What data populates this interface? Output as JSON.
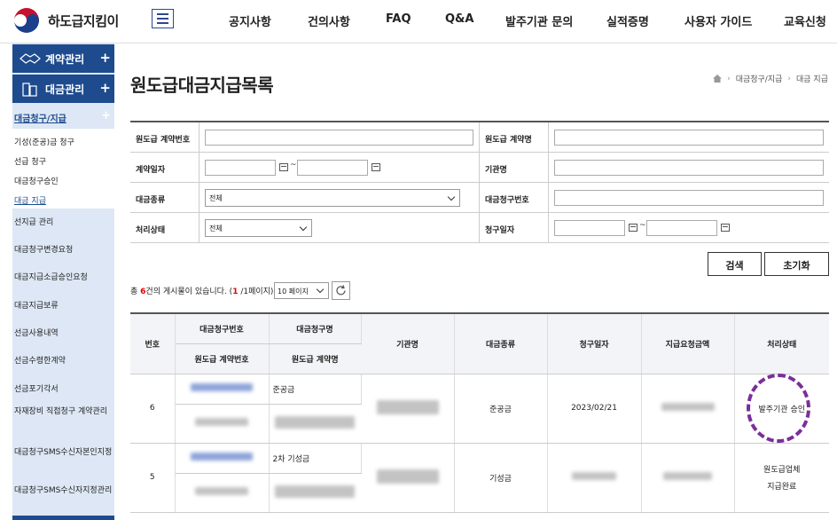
{
  "header": {
    "logo_text": "하도급지킴이",
    "nav": [
      "공지사항",
      "건의사항",
      "FAQ",
      "Q&A",
      "발주기관 문의",
      "실적증명",
      "사용자 가이드",
      "교육신청"
    ]
  },
  "sidebar": {
    "sections": [
      {
        "label": "계약관리",
        "icon": "handshake-icon"
      },
      {
        "label": "대금관리",
        "icon": "building-icon"
      }
    ],
    "submenu_title": "대금청구/지급",
    "submenu_items": [
      "기성(준공)금 청구",
      "선급 청구",
      "대금청구승인",
      "대금 지급"
    ],
    "items": [
      "선지급 관리",
      "대금청구변경요청",
      "대금지급소급승인요청",
      "대금지급보류",
      "선금사용내역",
      "선금수령한계약",
      "선금포기각서",
      "자재장비 직접청구 계약관리",
      "대금청구SMS수신자본인지정",
      "대금청구SMS수신자지정관리"
    ]
  },
  "page": {
    "title": "원도급대금지급목록",
    "breadcrumb": [
      "대금청구/지급",
      "대금 지급"
    ]
  },
  "form": {
    "contract_no_label": "원도급 계약번호",
    "contract_name_label": "원도급 계약명",
    "contract_date_label": "계약일자",
    "agency_label": "기관명",
    "payment_type_label": "대금종류",
    "payment_type_value": "전체",
    "claim_no_label": "대금청구번호",
    "status_label": "처리상태",
    "status_value": "전체",
    "claim_date_label": "청구일자",
    "tilde": "~",
    "search_button": "검색",
    "reset_button": "초기화"
  },
  "list": {
    "count_prefix": "총 ",
    "count": "6",
    "count_mid": "건의 게시물이 있습니다. (",
    "page_current": "1",
    "page_suffix": " /1페이지)",
    "per_page": "10 페이지"
  },
  "table": {
    "headers": {
      "no": "번호",
      "claim_no": "대금청구번호",
      "claim_name": "대금청구명",
      "contract_no": "원도급 계약번호",
      "contract_name": "원도급 계약명",
      "agency": "기관명",
      "payment_type": "대금종류",
      "claim_date": "청구일자",
      "amount": "지급요청금액",
      "status": "처리상태"
    },
    "rows": [
      {
        "no": "6",
        "claim_name": "준공금",
        "payment_type": "준공금",
        "claim_date": "2023/02/21",
        "status": "발주기관 승인"
      },
      {
        "no": "5",
        "claim_name": "2차 기성금",
        "payment_type": "기성금",
        "claim_date": "",
        "status_line1": "원도급업체",
        "status_line2": "지급완료"
      }
    ]
  }
}
